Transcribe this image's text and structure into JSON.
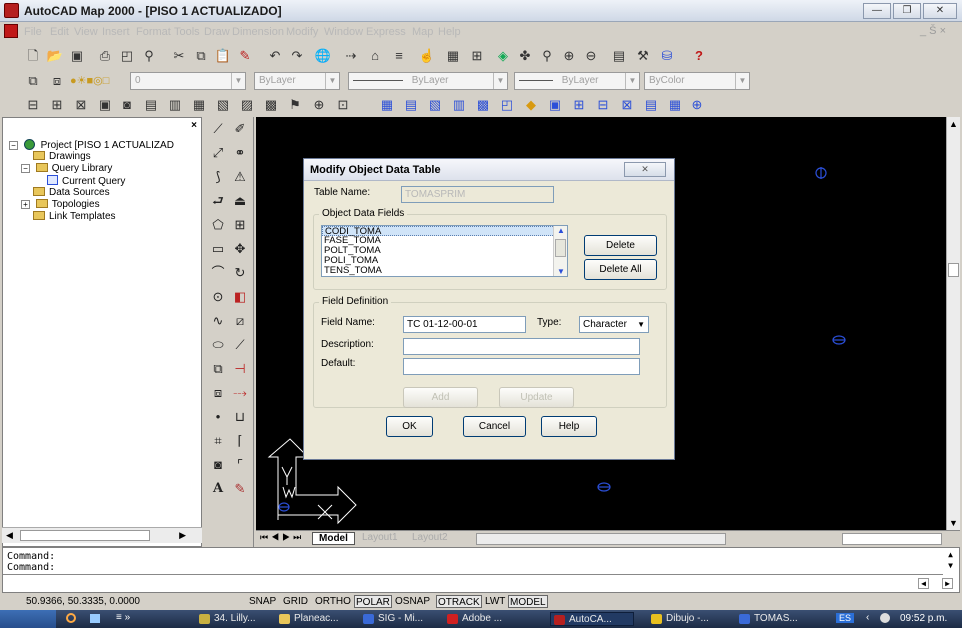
{
  "window": {
    "title": "AutoCAD Map 2000 - [PISO 1 ACTUALIZADO]",
    "minimize": "—",
    "restore": "❐",
    "close": "✕"
  },
  "menu": {
    "items": [
      "File",
      "Edit",
      "View",
      "Insert",
      "Format",
      "Tools",
      "Draw",
      "Dimension",
      "Modify",
      "Window",
      "Express",
      "Map",
      "Help"
    ],
    "mdi": "_ Š ×"
  },
  "properties": {
    "layer": "ByLayer",
    "linetype": "ByLayer",
    "lineweight": "ByLayer",
    "color": "ByColor",
    "layer_name": "0"
  },
  "panel": {
    "close": "×",
    "tree": [
      {
        "label": "Project [PISO 1 ACTUALIZAD",
        "expander": "−",
        "kind": "globe"
      },
      {
        "label": "Drawings",
        "kind": "folder"
      },
      {
        "label": "Query Library",
        "expander": "−",
        "kind": "folder"
      },
      {
        "label": "Current Query",
        "kind": "query"
      },
      {
        "label": "Data Sources",
        "kind": "folder"
      },
      {
        "label": "Topologies",
        "expander": "+",
        "kind": "folder"
      },
      {
        "label": "Link Templates",
        "kind": "folder"
      }
    ]
  },
  "layout_tabs": [
    "Model",
    "Layout1",
    "Layout2"
  ],
  "command": {
    "lines": [
      "Command:",
      "Command:"
    ]
  },
  "status": {
    "coords": "50.9366, 50.3335, 0.0000",
    "toggles": [
      {
        "label": "SNAP",
        "on": false
      },
      {
        "label": "GRID",
        "on": false
      },
      {
        "label": "ORTHO",
        "on": false
      },
      {
        "label": "POLAR",
        "on": true
      },
      {
        "label": "OSNAP",
        "on": false
      },
      {
        "label": "OTRACK",
        "on": true
      },
      {
        "label": "LWT",
        "on": false
      },
      {
        "label": "MODEL",
        "on": true
      }
    ]
  },
  "dialog": {
    "title": "Modify Object Data Table",
    "close": "✕",
    "table_name_label": "Table Name:",
    "table_name": "TOMASPRIM",
    "object_fields_label": "Object Data Fields",
    "fields": [
      "CODI_TOMA",
      "FASE_TOMA",
      "POLT_TOMA",
      "POLI_TOMA",
      "TENS_TOMA"
    ],
    "delete": "Delete",
    "delete_all": "Delete All",
    "field_def_label": "Field Definition",
    "field_name_label": "Field Name:",
    "field_name": "TC 01-12-00-01",
    "type_label": "Type:",
    "type": "Character",
    "description_label": "Description:",
    "description": "",
    "default_label": "Default:",
    "default": "",
    "add": "Add",
    "update": "Update",
    "ok": "OK",
    "cancel": "Cancel",
    "help": "Help"
  },
  "taskbar": {
    "items": [
      "34. Lilly...",
      "Planeac...",
      "SIG - Mi...",
      "Adobe ...",
      "AutoCA...",
      "Dibujo -...",
      "TOMAS..."
    ],
    "lang": "ES",
    "clock": "09:52 p.m."
  },
  "colors": {
    "canvas": "#000000",
    "accent_blue": "#2b4fd8",
    "dialog_bg": "#ece9d8"
  }
}
